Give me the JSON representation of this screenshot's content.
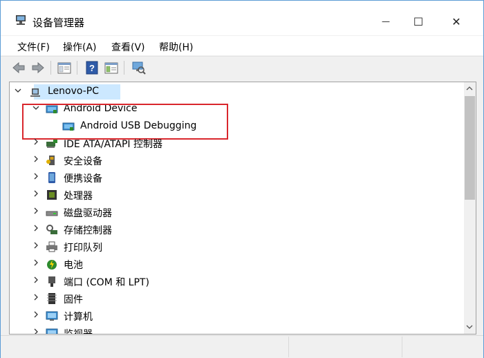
{
  "window": {
    "title": "设备管理器",
    "minimize_glyph": "—",
    "maximize_glyph": "☐",
    "close_glyph": "✕"
  },
  "menu": [
    {
      "label": "文件(F)"
    },
    {
      "label": "操作(A)"
    },
    {
      "label": "查看(V)"
    },
    {
      "label": "帮助(H)"
    }
  ],
  "toolbar": {
    "buttons": [
      "back-icon",
      "forward-icon",
      "properties-icon",
      "help-icon",
      "update-driver-icon",
      "scan-hardware-icon"
    ]
  },
  "tree": {
    "root": "Lenovo-PC",
    "items": [
      {
        "label": "Android Device",
        "expanded": true
      },
      {
        "label": "Android USB Debugging",
        "child": true
      },
      {
        "label": "IDE ATA/ATAPI 控制器"
      },
      {
        "label": "安全设备"
      },
      {
        "label": "便携设备"
      },
      {
        "label": "处理器"
      },
      {
        "label": "磁盘驱动器"
      },
      {
        "label": "存储控制器"
      },
      {
        "label": "打印队列"
      },
      {
        "label": "电池"
      },
      {
        "label": "端口 (COM 和 LPT)"
      },
      {
        "label": "固件"
      },
      {
        "label": "计算机"
      },
      {
        "label": "监视器"
      }
    ]
  },
  "colors": {
    "selection": "#cce8ff",
    "highlight_border": "#d9262c",
    "window_border": "#5b9bd5"
  }
}
